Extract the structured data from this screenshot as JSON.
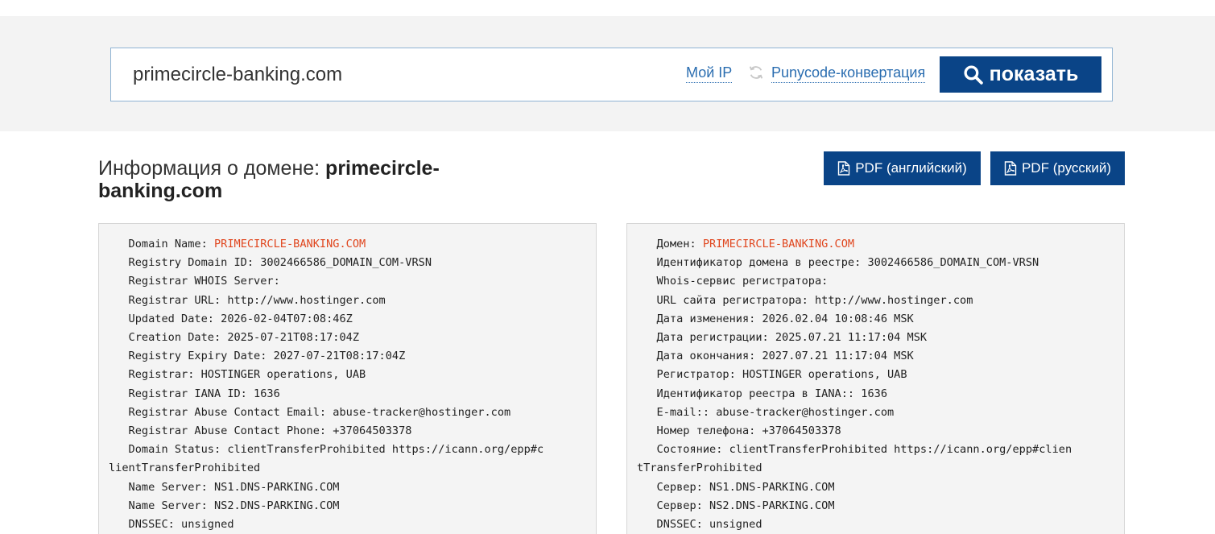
{
  "search": {
    "value": "primecircle-banking.com",
    "my_ip": "Мой IP",
    "punycode": "Punycode-конвертация",
    "button": "показать"
  },
  "title": {
    "prefix": "Информация о домене: ",
    "domain_part1": "primecircle-",
    "domain_part2": "banking.com"
  },
  "pdf": {
    "english": "PDF (английский)",
    "russian": "PDF (русский)"
  },
  "whois_en": {
    "domain_label": "   Domain Name: ",
    "domain_value": "PRIMECIRCLE-BANKING.COM",
    "lines_a": [
      "   Registry Domain ID: 3002466586_DOMAIN_COM-VRSN",
      "   Registrar WHOIS Server:",
      "   Registrar URL: http://www.hostinger.com",
      "   Updated Date: 2026-02-04T07:08:46Z",
      "   Creation Date: 2025-07-21T08:17:04Z",
      "   Registry Expiry Date: 2027-07-21T08:17:04Z",
      "   Registrar: HOSTINGER operations, UAB",
      "   Registrar IANA ID: 1636",
      "   Registrar Abuse Contact Email: abuse-tracker@hostinger.com",
      "   Registrar Abuse Contact Phone: +37064503378",
      "   Domain Status: clientTransferProhibited https://icann.org/epp#c",
      "lientTransferProhibited",
      "   Name Server: NS1.DNS-PARKING.COM",
      "   Name Server: NS2.DNS-PARKING.COM",
      "   DNSSEC: unsigned"
    ]
  },
  "whois_ru": {
    "domain_label": "   Домен: ",
    "domain_value": "PRIMECIRCLE-BANKING.COM",
    "lines_a": [
      "   Идентификатор домена в реестре: 3002466586_DOMAIN_COM-VRSN",
      "   Whois-сервис регистратора:",
      "   URL сайта регистратора: http://www.hostinger.com",
      "   Дата изменения: 2026.02.04 10:08:46 MSK",
      "   Дата регистрации: 2025.07.21 11:17:04 MSK",
      "   Дата окончания: 2027.07.21 11:17:04 MSK",
      "   Регистратор: HOSTINGER operations, UAB",
      "   Идентификатор реестра в IANA:: 1636",
      "   E-mail:: abuse-tracker@hostinger.com",
      "   Номер телефона: +37064503378",
      "   Состояние: clientTransferProhibited https://icann.org/epp#clien",
      "tTransferProhibited",
      "   Сервер: NS1.DNS-PARKING.COM",
      "   Сервер: NS2.DNS-PARKING.COM",
      "   DNSSEC: unsigned"
    ]
  }
}
